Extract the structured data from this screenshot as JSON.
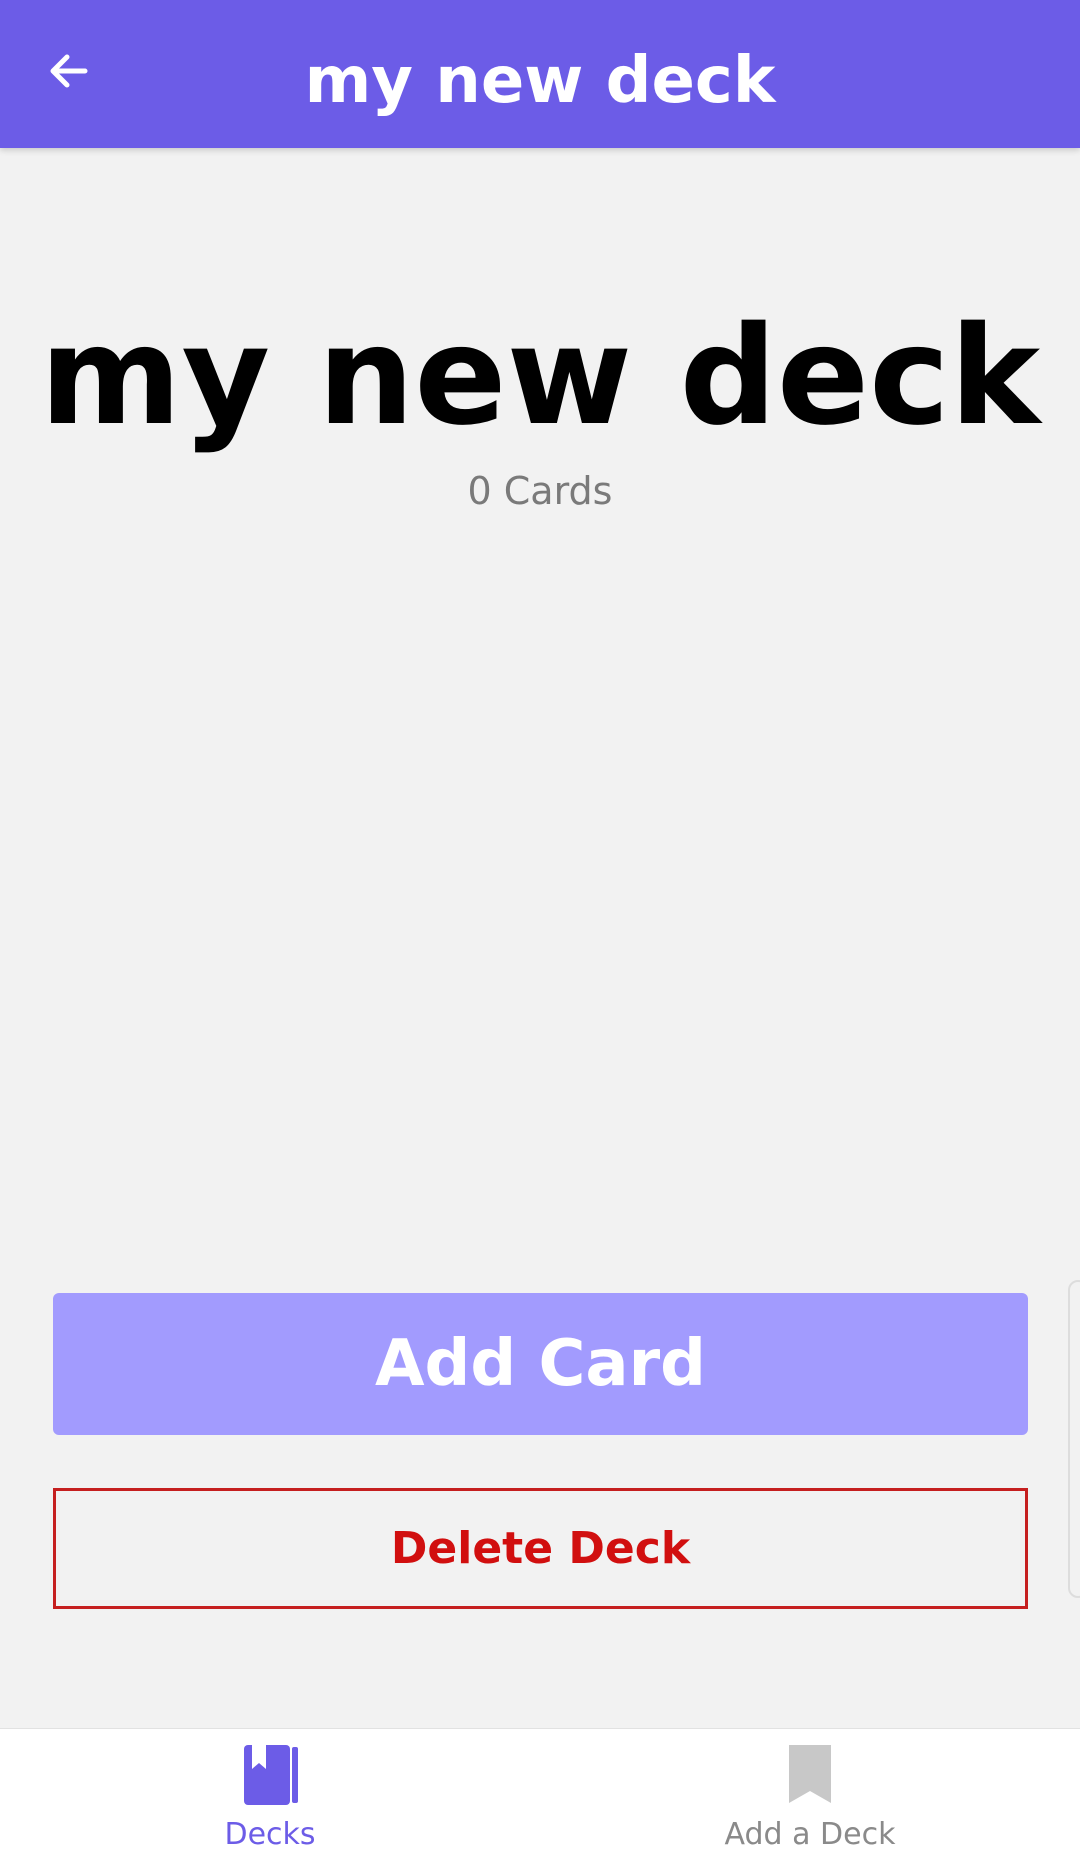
{
  "header": {
    "title": "my new deck"
  },
  "deck": {
    "title": "my new deck",
    "count_label": "0 Cards"
  },
  "actions": {
    "add_card_label": "Add Card",
    "delete_deck_label": "Delete Deck"
  },
  "tabs": [
    {
      "label": "Decks",
      "icon": "book-icon",
      "active": true
    },
    {
      "label": "Add a Deck",
      "icon": "bookmark-icon",
      "active": false
    }
  ],
  "colors": {
    "primary": "#6c5ce7",
    "button": "#a29bfe",
    "danger": "#d10f0f",
    "inactive": "#8a8a8a"
  }
}
